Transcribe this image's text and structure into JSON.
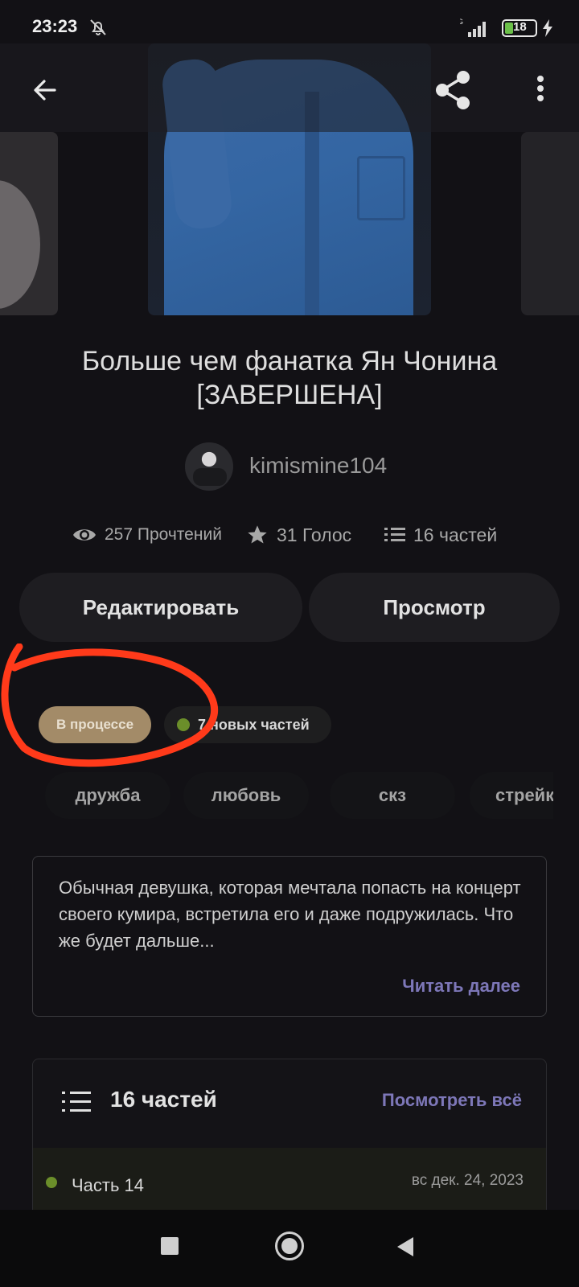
{
  "status_bar": {
    "time": "23:23",
    "network": "4G",
    "battery": "18"
  },
  "icons": {
    "back": "arrow-left-icon",
    "share": "share-icon",
    "more": "more-vertical-icon",
    "views": "eye-icon",
    "votes": "star-icon",
    "parts": "list-icon",
    "silent": "bell-off-icon"
  },
  "story": {
    "title_line1": "Больше чем фанатка Ян Чонина",
    "title_line2": "[ЗАВЕРШЕНА]",
    "author": "kimismine104",
    "stats": {
      "reads": "257 Прочтений",
      "votes": "31 Голос",
      "parts": "16 частей"
    }
  },
  "actions": {
    "edit_label": "Редактировать",
    "preview_label": "Просмотр"
  },
  "status": {
    "label": "В процессе",
    "new_parts": "7 новых частей"
  },
  "tags": [
    "дружба",
    "любовь",
    "скз",
    "стрейк"
  ],
  "description": {
    "text": "Обычная девушка, которая мечтала попасть на концерт своего кумира, встретила его и даже подружилась. Что же будет дальше...",
    "read_more": "Читать далее"
  },
  "parts": {
    "title": "16 частей",
    "view_all": "Посмотреть всё",
    "items": [
      {
        "name": "Часть 14",
        "date": "вс дек. 24, 2023"
      }
    ]
  },
  "colors": {
    "background": "#121115",
    "status_pill": "#a38b68",
    "accent_link": "#7d77b8",
    "new_dot": "#6b8e2a",
    "annotation": "#ff3a1a"
  }
}
